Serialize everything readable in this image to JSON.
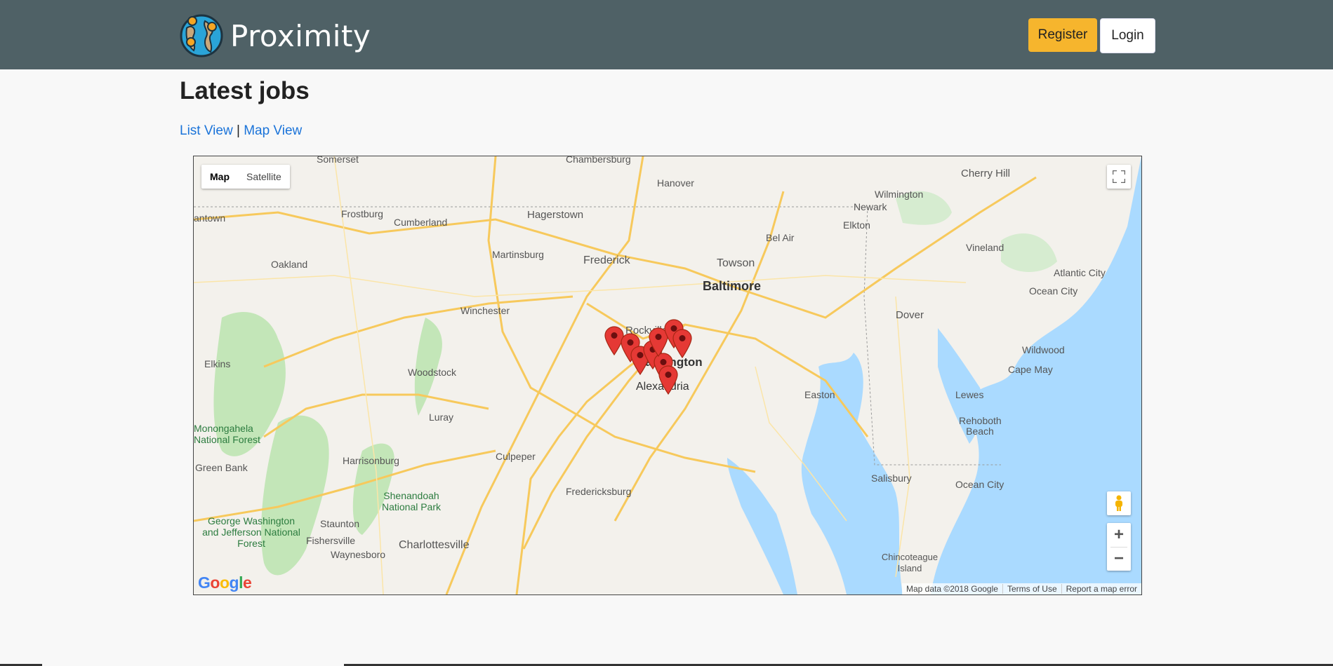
{
  "header": {
    "brand_name": "Proximity",
    "register_label": "Register",
    "login_label": "Login"
  },
  "main": {
    "heading": "Latest jobs",
    "list_view_label": "List View",
    "separator": "|",
    "map_view_label": "Map View"
  },
  "map": {
    "type_map_label": "Map",
    "type_satellite_label": "Satellite",
    "zoom_in_label": "+",
    "zoom_out_label": "−",
    "attribution": "Map data ©2018 Google",
    "terms_label": "Terms of Use",
    "report_label": "Report a map error",
    "google_logo": "Google",
    "places": {
      "chambersburg": "Chambersburg",
      "somerset": "Somerset",
      "hanover": "Hanover",
      "cherry_hill": "Cherry Hill",
      "wilmington": "Wilmington",
      "newark": "Newark",
      "elkton": "Elkton",
      "frostburg": "Frostburg",
      "cumberland": "Cumberland",
      "hagerstown": "Hagerstown",
      "morgantown": "antown",
      "bel_air": "Bel Air",
      "vineland": "Vineland",
      "martinsburg": "Martinsburg",
      "frederick": "Frederick",
      "towson": "Towson",
      "oakland": "Oakland",
      "baltimore": "Baltimore",
      "atlantic_city": "Atlantic City",
      "ocean_city_nj": "Ocean City",
      "winchester": "Winchester",
      "rockville": "Rockville",
      "dover": "Dover",
      "wildwood": "Wildwood",
      "cape_may": "Cape May",
      "elkins": "Elkins",
      "woodstock": "Woodstock",
      "washington": "Washington",
      "alexandria": "Alexandria",
      "easton": "Easton",
      "lewes": "Lewes",
      "rehoboth": "Rehoboth Beach",
      "luray": "Luray",
      "monongahela": "Monongahela National Forest",
      "culpeper": "Culpeper",
      "harrisonburg": "Harrisonburg",
      "green_bank": "Green Bank",
      "salisbury": "Salisbury",
      "ocean_city_md": "Ocean City",
      "shenandoah": "Shenandoah National Park",
      "fredericksburg": "Fredericksburg",
      "staunton": "Staunton",
      "george_washington": "George Washington and Jefferson National Forest",
      "fishersville": "Fishersville",
      "charlottesville": "Charlottesville",
      "waynesboro": "Waynesboro",
      "chincoteague": "Chincoteague Island"
    },
    "markers_count": 9
  },
  "colors": {
    "header_bg": "#4f6166",
    "register_bg": "#f6b52d",
    "link": "#1a73d9",
    "water": "#aadaff",
    "park": "#c3e6b8",
    "marker": "#e53935"
  }
}
